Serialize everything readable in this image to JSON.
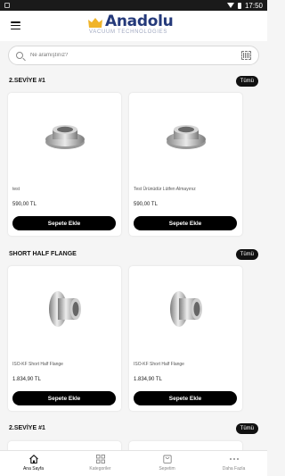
{
  "status_bar": {
    "time": "17:50"
  },
  "brand": {
    "name": "Anadolu",
    "tagline": "VACUUM TECHNOLOGIES"
  },
  "search": {
    "placeholder": "Ne aramıştınız?"
  },
  "sections": [
    {
      "title": "2.SEVİYE #1",
      "see_all": "Tümü",
      "products": [
        {
          "name": "test",
          "price": "590,00 TL",
          "button": "Sepete Ekle"
        },
        {
          "name": "Test Ürünüdür Lütfen Almayınız",
          "price": "590,00 TL",
          "button": "Sepete Ekle"
        }
      ]
    },
    {
      "title": "SHORT HALF FLANGE",
      "see_all": "Tümü",
      "products": [
        {
          "name": "ISO-KF Short Half Flange",
          "price": "1.834,90 TL",
          "button": "Sepete Ekle"
        },
        {
          "name": "ISO-KF Short Half Flange",
          "price": "1.834,90 TL",
          "button": "Sepete Ekle"
        }
      ]
    },
    {
      "title": "2.SEVİYE #1",
      "see_all": "Tümü"
    }
  ],
  "bottom_nav": [
    {
      "label": "Ana Sayfa",
      "icon": "home-icon",
      "active": true
    },
    {
      "label": "Kategoriler",
      "icon": "grid-icon",
      "active": false
    },
    {
      "label": "Sepetim",
      "icon": "cart-icon",
      "active": false
    },
    {
      "label": "Daha Fazla",
      "icon": "more-icon",
      "active": false
    }
  ],
  "colors": {
    "brand_blue": "#24397a",
    "brand_gold": "#f0b42a",
    "button_black": "#000000"
  }
}
